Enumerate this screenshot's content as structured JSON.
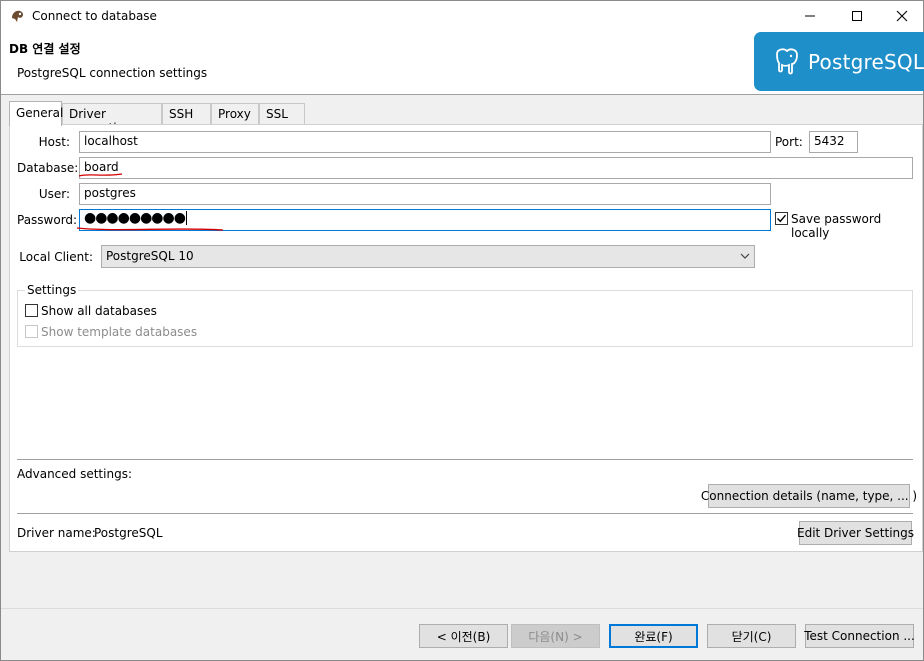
{
  "window": {
    "title": "Connect to database",
    "controls": {
      "minimize": "–",
      "maximize": "☐",
      "close": "✕"
    }
  },
  "header": {
    "title": "DB 연결 설정",
    "subtitle": "PostgreSQL connection settings",
    "logo_text": "PostgreSQL",
    "logo_color": "#1f8fc9"
  },
  "tabs": [
    {
      "label": "General",
      "active": true
    },
    {
      "label": "Driver properties"
    },
    {
      "label": "SSH"
    },
    {
      "label": "Proxy"
    },
    {
      "label": "SSL"
    }
  ],
  "form": {
    "host_label": "Host:",
    "host_value": "localhost",
    "port_label": "Port:",
    "port_value": "5432",
    "database_label": "Database:",
    "database_value": "board",
    "user_label": "User:",
    "user_value": "postgres",
    "password_label": "Password:",
    "password_value": "●●●●●●●●●",
    "save_password_label": "Save password locally",
    "save_password_checked": true,
    "local_client_label": "Local Client:",
    "local_client_value": "PostgreSQL 10"
  },
  "settings": {
    "title": "Settings",
    "show_all_label": "Show all databases",
    "show_all_checked": false,
    "show_template_label": "Show template databases",
    "show_template_enabled": false
  },
  "advanced": {
    "label": "Advanced settings:",
    "connection_details_button": "Connection details (name, type, ... )"
  },
  "driver": {
    "label": "Driver name:",
    "value": "PostgreSQL",
    "edit_button": "Edit Driver Settings"
  },
  "footer": {
    "back_button": "< 이전(B)",
    "next_button": "다음(N) >",
    "finish_button": "완료(F)",
    "close_button": "닫기(C)",
    "test_button": "Test Connection ..."
  },
  "colors": {
    "accent": "#0078d7",
    "annotation": "#d40000"
  }
}
